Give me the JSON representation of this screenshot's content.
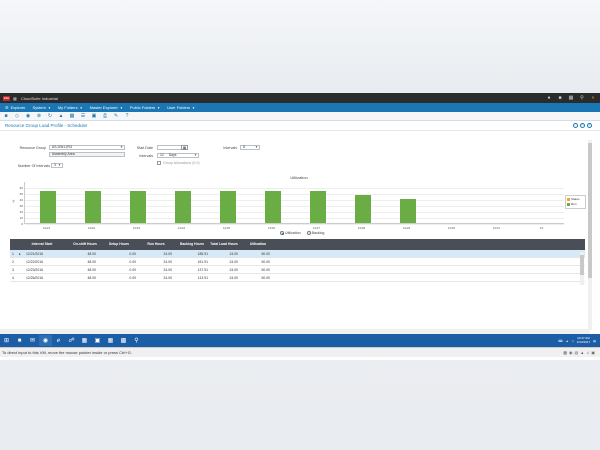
{
  "app": {
    "logo": "infor",
    "title": "CloudSuite Industrial",
    "header_icons": [
      "user-icon",
      "messages-icon",
      "apps-icon",
      "search-icon",
      "collapse-icon"
    ]
  },
  "menubar": {
    "items": [
      {
        "label": "Explorer",
        "icon": "hamburger-icon"
      },
      {
        "label": "System",
        "caret": true
      },
      {
        "label": "My Folders",
        "caret": true
      },
      {
        "label": "Master Explorer",
        "caret": true
      },
      {
        "label": "Public Folders",
        "caret": true
      },
      {
        "label": "User Folders",
        "caret": true
      }
    ]
  },
  "page": {
    "title": "Resource Group Load Profile - Scheduler"
  },
  "form": {
    "resource_group_label": "Resource Group",
    "resource_group_value": "AS-DW-LIRG",
    "resource_group_desc": "Assembly Area",
    "start_date_label": "Start Date",
    "start_date_value": "",
    "intervals_label": "Intervals",
    "intervals_value": "12",
    "intervals_unit": "Days",
    "interval_size_label": "Intervals",
    "interval_size_value": "8",
    "group_allocations_label": "Group Allocations (9.0)",
    "num_utilizations_label": "Number Of Intervals",
    "num_utilizations_value": "3"
  },
  "chart_data": {
    "type": "bar",
    "title": "Utilization",
    "categories": [
      "12/21",
      "12/22",
      "12/23",
      "12/24",
      "12/25",
      "12/26",
      "12/27",
      "12/28",
      "12/29",
      "12/30",
      "12/31",
      "1/1"
    ],
    "values": [
      53.96,
      53.96,
      53.96,
      53.96,
      53.96,
      53.96,
      53.96,
      46.0,
      40.0,
      0,
      0,
      0
    ],
    "ylim": [
      0,
      70
    ],
    "yticks": [
      0,
      10,
      20,
      30,
      40,
      50,
      60
    ],
    "ylabel": "%",
    "legend": [
      {
        "name": "Status",
        "color": "#f5a623"
      },
      {
        "name": "Run",
        "color": "#6aad45"
      }
    ],
    "legend_position": "right",
    "grid": true
  },
  "view_options": {
    "utilization_label": "Utilization",
    "backlog_label": "Backlog",
    "selected": "utilization"
  },
  "table": {
    "columns": [
      "Interval Start",
      "On-shift Hours",
      "Setup Hours",
      "Run Hours",
      "Backlog Hours",
      "Total Load Hours",
      "Utilization"
    ],
    "rows": [
      {
        "num": "1",
        "marker": "▸",
        "start": "12/21/2016",
        "onshift": "48.00",
        "setup": "0.00",
        "run": "24.00",
        "backlog": "185.91",
        "total": "24.00",
        "util": "50.00"
      },
      {
        "num": "2",
        "marker": "",
        "start": "12/22/2016",
        "onshift": "48.00",
        "setup": "0.00",
        "run": "24.00",
        "backlog": "161.91",
        "total": "24.00",
        "util": "50.00"
      },
      {
        "num": "3",
        "marker": "",
        "start": "12/23/2016",
        "onshift": "48.00",
        "setup": "0.00",
        "run": "24.00",
        "backlog": "137.91",
        "total": "24.00",
        "util": "50.00"
      },
      {
        "num": "4",
        "marker": "",
        "start": "12/26/2016",
        "onshift": "48.00",
        "setup": "0.00",
        "run": "24.00",
        "backlog": "113.91",
        "total": "24.00",
        "util": "50.00"
      }
    ]
  },
  "taskbar": {
    "time": "10:47 AM",
    "date": "2/13/2017",
    "apps": [
      "windows-start-icon",
      "file-explorer-icon",
      "outlook-icon",
      "chrome-icon",
      "ie-icon",
      "network-icon",
      "excel-icon",
      "project-icon",
      "excel-alt-icon",
      "cmd-icon",
      "search-app-icon"
    ]
  },
  "vm_status": {
    "message": "To direct input to this VM, move the mouse pointer inside or press Ctrl+G."
  }
}
